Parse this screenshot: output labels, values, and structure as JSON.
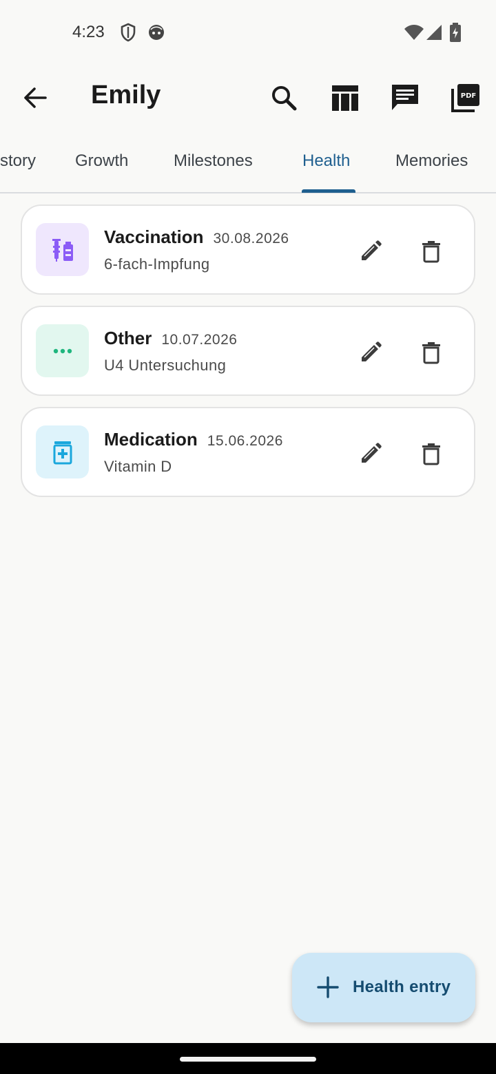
{
  "status_bar": {
    "time": "4:23",
    "left_icons": [
      "shield-icon",
      "face-icon"
    ],
    "right_icons": [
      "wifi-icon",
      "signal-icon",
      "battery-charging-icon"
    ]
  },
  "app_bar": {
    "title": "Emily",
    "actions": [
      "search-icon",
      "table-icon",
      "chat-icon",
      "pdf-icon"
    ]
  },
  "tabs": [
    {
      "label": "History",
      "visible_text": "story",
      "active": false
    },
    {
      "label": "Growth",
      "active": false
    },
    {
      "label": "Milestones",
      "active": false
    },
    {
      "label": "Health",
      "active": true
    },
    {
      "label": "Memories",
      "active": false
    }
  ],
  "entries": [
    {
      "type": "Vaccination",
      "date": "30.08.2026",
      "description": "6-fach-Impfung",
      "icon": "vaccine-icon",
      "badge_bg": "#efe7fd",
      "icon_color": "#8b5cf6"
    },
    {
      "type": "Other",
      "date": "10.07.2026",
      "description": "U4 Untersuchung",
      "icon": "more-dots-icon",
      "badge_bg": "#e2f7ef",
      "icon_color": "#1fb67e"
    },
    {
      "type": "Medication",
      "date": "15.06.2026",
      "description": "Vitamin D",
      "icon": "medication-icon",
      "badge_bg": "#def3fb",
      "icon_color": "#1aa7dc"
    }
  ],
  "fab": {
    "label": "Health entry",
    "icon": "plus-icon"
  },
  "colors": {
    "accent": "#1f5f8f",
    "fab_bg": "#cde7f7",
    "background": "#f9f9f7"
  }
}
